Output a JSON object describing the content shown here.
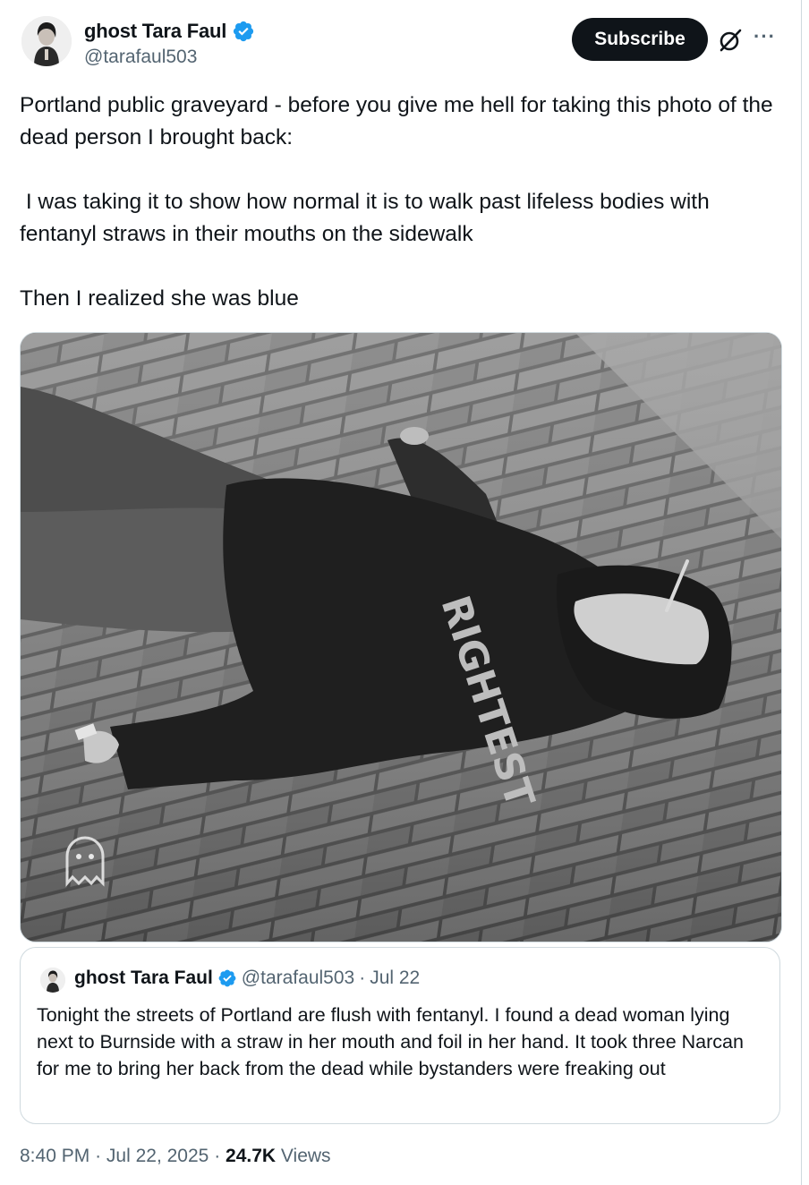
{
  "author": {
    "display_name": "ghost Tara Faul",
    "handle": "@tarafaul503",
    "verified": true
  },
  "actions": {
    "subscribe_label": "Subscribe",
    "more_label": "···"
  },
  "tweet": {
    "paragraphs": [
      "Portland public graveyard - before you give me hell for taking this photo of the dead person I brought back:",
      " I was taking it to show how normal it is to walk past lifeless bodies with fentanyl straws in their mouths on the sidewalk",
      "Then I realized she was blue"
    ],
    "photo_hoodie_text": "RIGHTEST"
  },
  "quoted_tweet": {
    "display_name": "ghost Tara Faul",
    "handle": "@tarafaul503",
    "separator": "·",
    "date": "Jul 22",
    "text": "Tonight the streets of Portland are flush with fentanyl. I found a dead woman lying next to Burnside with a straw in her mouth and foil in her hand. It took three Narcan for me to bring her back from the dead while bystanders were freaking out"
  },
  "footer": {
    "time": "8:40 PM",
    "separator": "·",
    "date": "Jul 22, 2025",
    "views_count": "24.7K",
    "views_label": "Views"
  },
  "colors": {
    "text": "#0f1419",
    "secondary": "#536471",
    "verified_blue": "#1d9bf0",
    "border": "#cfd9de"
  }
}
